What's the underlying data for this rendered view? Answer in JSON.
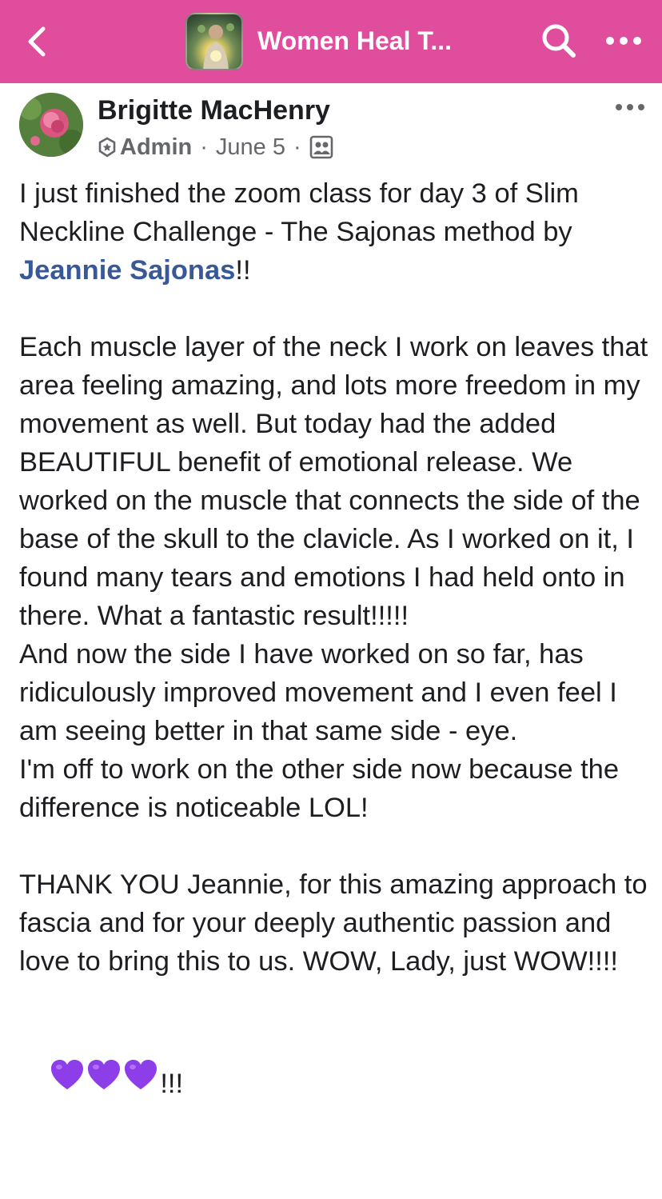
{
  "header": {
    "title": "Women Heal T...",
    "back_icon": "chevron-left-icon",
    "search_icon": "search-icon",
    "more_icon": "more-horizontal-icon",
    "bar_color": "#e04d9c"
  },
  "post": {
    "author": "Brigitte MacHenry",
    "role": "Admin",
    "date": "June 5",
    "separator": "·",
    "audience_icon": "members-icon",
    "more_icon": "more-horizontal-icon",
    "paragraph_1_before": "I just finished the zoom class for day 3 of Slim Neckline Challenge - The Sajonas method by ",
    "mention": "Jeannie Sajonas",
    "paragraph_1_after": "!!",
    "paragraph_2": "Each muscle layer of the neck I work on leaves that area feeling amazing, and lots more freedom in my movement as well. But today had the added BEAUTIFUL benefit of emotional release. We worked on the muscle that connects the side of the base of the skull to the clavicle. As I worked on it, I found many tears and emotions I had held onto in there. What a fantastic result!!!!!\nAnd now the side I have worked on so far, has ridiculously improved movement and I even feel I am seeing better in that same side - eye.\nI'm off to work on the other side now because the difference is noticeable LOL!",
    "paragraph_3": "THANK YOU Jeannie, for this amazing approach to fascia and for your deeply authentic passion and love to bring this to us. WOW, Lady, just WOW!!!!",
    "closing_icon": "purple-heart-icon",
    "closing_icon_count": 3,
    "closing_text": "!!!",
    "mention_color": "#385898",
    "heart_color": "#8e3ee8"
  }
}
